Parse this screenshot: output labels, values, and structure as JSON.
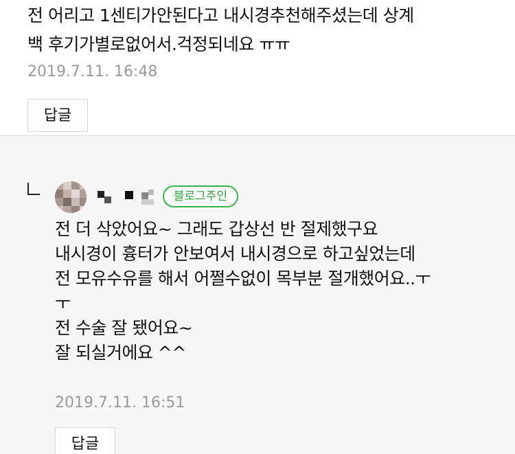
{
  "comment": {
    "text": "전 어리고 1센티가안된다고 내시경추천해주셨는데 상계\n백 후기가별로없어서.걱정되네요 ㅠㅠ",
    "date": "2019.7.11. 16:48",
    "reply_label": "답글"
  },
  "reply": {
    "badge": "블로그주인",
    "lines": [
      "전 더 삭았어요~ 그래도 갑상선 반 절제했구요",
      "내시경이 흉터가 안보여서 내시경으로 하고싶었는데",
      "전 모유수유를 해서 어쩔수없이 목부분 절개했어요..ㅜ",
      "ㅜ",
      "전 수술 잘 됐어요~",
      "잘 되실거에요 ^^"
    ],
    "date": "2019.7.11. 16:51",
    "reply_label": "답글"
  }
}
